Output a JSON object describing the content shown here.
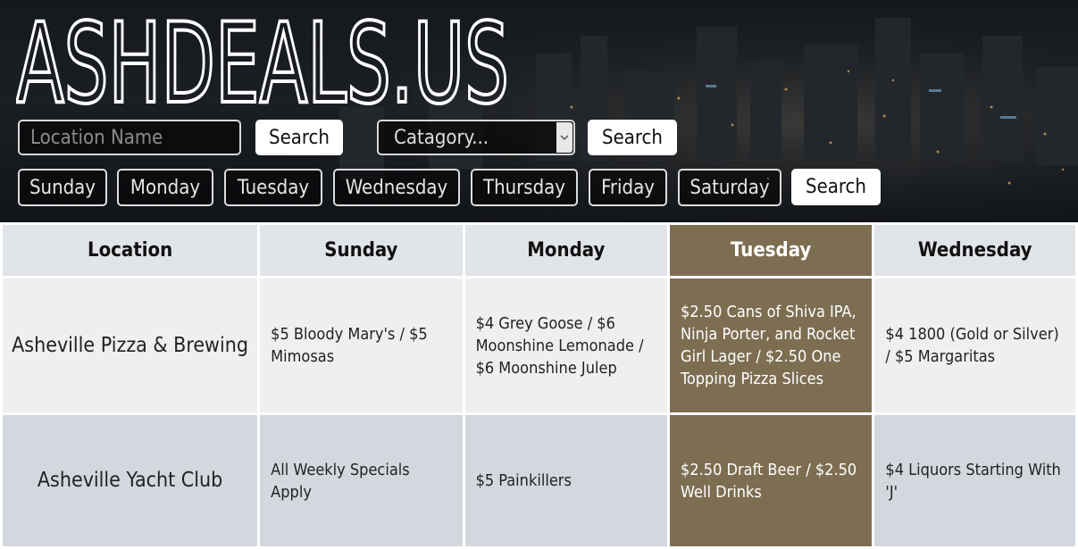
{
  "site": {
    "title": "ASHDEALS.US"
  },
  "search": {
    "location_placeholder": "Location Name",
    "location_button": "Search",
    "category_selected": "Catagory...",
    "category_button": "Search",
    "days": [
      "Sunday",
      "Monday",
      "Tuesday",
      "Wednesday",
      "Thursday",
      "Friday",
      "Saturday"
    ],
    "day_button": "Search"
  },
  "table": {
    "headers": [
      "Location",
      "Sunday",
      "Monday",
      "Tuesday",
      "Wednesday"
    ],
    "highlighted_column": "Tuesday",
    "rows": [
      {
        "location": "Asheville Pizza & Brewing",
        "sunday": "$5 Bloody Mary's / $5 Mimosas",
        "monday": "$4 Grey Goose / $6 Moonshine Lemonade / $6 Moonshine Julep",
        "tuesday": "$2.50 Cans of Shiva IPA, Ninja Porter, and Rocket Girl Lager / $2.50 One Topping Pizza Slices",
        "wednesday": "$4 1800 (Gold or Silver) / $5 Margaritas"
      },
      {
        "location": "Asheville Yacht Club",
        "sunday": "All Weekly Specials Apply",
        "monday": "$5 Painkillers",
        "tuesday": "$2.50 Draft Beer / $2.50 Well Drinks",
        "wednesday": "$4 Liquors Starting With 'J'"
      }
    ]
  },
  "colors": {
    "header_bg": "#1b1f24",
    "highlight": "#7d6e52",
    "table_header_bg": "#e1e4e8",
    "row_light": "#efefef",
    "row_dark": "#d3d8df"
  }
}
